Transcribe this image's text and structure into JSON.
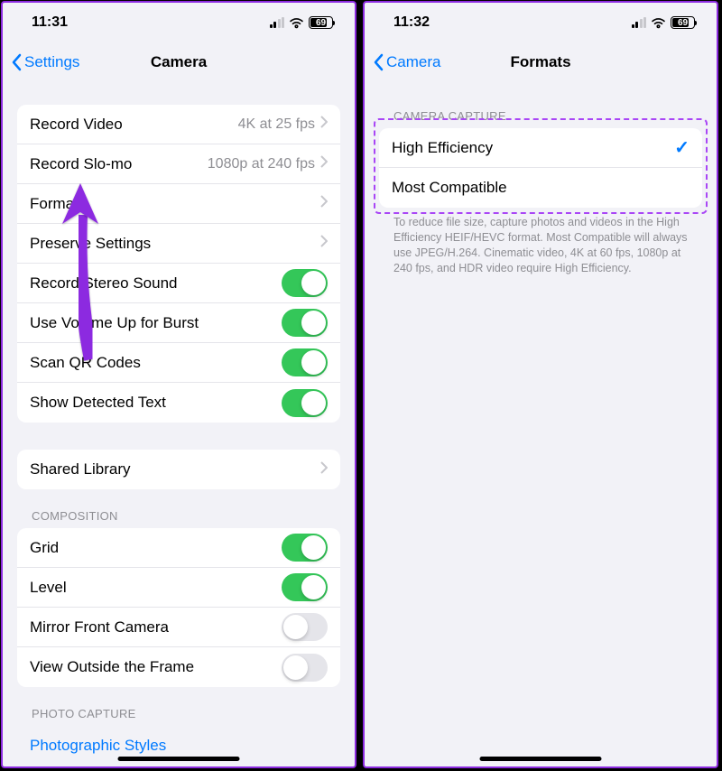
{
  "left": {
    "time": "11:31",
    "battery": "69",
    "back_label": "Settings",
    "title": "Camera",
    "rows1": [
      {
        "label": "Record Video",
        "detail": "4K at 25 fps"
      },
      {
        "label": "Record Slo-mo",
        "detail": "1080p at 240 fps"
      },
      {
        "label": "Formats",
        "detail": ""
      },
      {
        "label": "Preserve Settings",
        "detail": ""
      }
    ],
    "toggles1": [
      {
        "label": "Record Stereo Sound",
        "on": true
      },
      {
        "label": "Use Volume Up for Burst",
        "on": true
      },
      {
        "label": "Scan QR Codes",
        "on": true
      },
      {
        "label": "Show Detected Text",
        "on": true
      }
    ],
    "rows2": [
      {
        "label": "Shared Library",
        "detail": ""
      }
    ],
    "section_composition": "COMPOSITION",
    "toggles2": [
      {
        "label": "Grid",
        "on": true
      },
      {
        "label": "Level",
        "on": true
      },
      {
        "label": "Mirror Front Camera",
        "on": false
      },
      {
        "label": "View Outside the Frame",
        "on": false
      }
    ],
    "section_photo": "PHOTO CAPTURE",
    "photo_row": "Photographic Styles"
  },
  "right": {
    "time": "11:32",
    "battery": "69",
    "back_label": "Camera",
    "title": "Formats",
    "section_camera": "CAMERA CAPTURE",
    "rows": [
      {
        "label": "High Efficiency",
        "checked": true
      },
      {
        "label": "Most Compatible",
        "checked": false
      }
    ],
    "footer": "To reduce file size, capture photos and videos in the High Efficiency HEIF/HEVC format. Most Compatible will always use JPEG/H.264. Cinematic video, 4K at 60 fps, 1080p at 240 fps, and HDR video require High Efficiency."
  }
}
